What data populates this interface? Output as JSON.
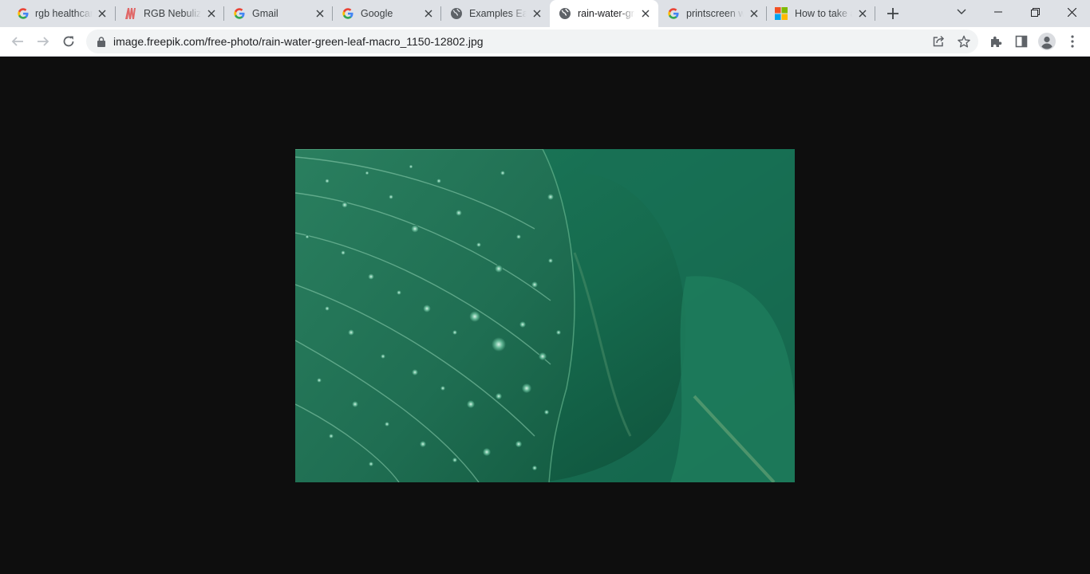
{
  "tabs": [
    {
      "title": "rgb healthcare",
      "favicon": "google-g-icon",
      "active": false
    },
    {
      "title": "RGB Nebulizer",
      "favicon": "rgb-logo-icon",
      "active": false
    },
    {
      "title": "Gmail",
      "favicon": "google-g-icon",
      "active": false
    },
    {
      "title": "Google",
      "favicon": "google-g-icon",
      "active": false
    },
    {
      "title": "Examples Easy",
      "favicon": "globe-icon",
      "active": false
    },
    {
      "title": "rain-water-green",
      "favicon": "globe-icon",
      "active": true
    },
    {
      "title": "printscreen w",
      "favicon": "google-g-icon",
      "active": false
    },
    {
      "title": "How to take a",
      "favicon": "microsoft-logo-icon",
      "active": false
    }
  ],
  "address_bar": {
    "url": "image.freepik.com/free-photo/rain-water-green-leaf-macro_1150-12802.jpg"
  },
  "colors": {
    "tabstrip": "#dee1e6",
    "active_tab": "#ffffff",
    "omnibox": "#f1f3f4",
    "viewer_background": "#0e0e0e",
    "leaf_green": "#1f7a58"
  },
  "content": {
    "image_subject": "rain water droplets on green leaf macro"
  }
}
